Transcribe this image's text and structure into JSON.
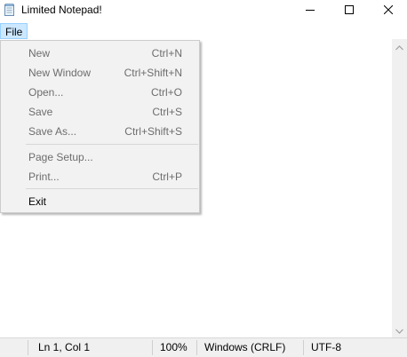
{
  "window": {
    "title": "Limited Notepad!",
    "icon": "notepad-icon",
    "controls": [
      "minimize-icon",
      "maximize-icon",
      "close-icon"
    ]
  },
  "menubar": {
    "items": [
      {
        "label": "File",
        "state": "open"
      }
    ]
  },
  "file_menu": {
    "groups": [
      [
        {
          "label": "New",
          "shortcut": "Ctrl+N",
          "enabled": false
        },
        {
          "label": "New Window",
          "shortcut": "Ctrl+Shift+N",
          "enabled": false
        },
        {
          "label": "Open...",
          "shortcut": "Ctrl+O",
          "enabled": false
        },
        {
          "label": "Save",
          "shortcut": "Ctrl+S",
          "enabled": false
        },
        {
          "label": "Save As...",
          "shortcut": "Ctrl+Shift+S",
          "enabled": false
        }
      ],
      [
        {
          "label": "Page Setup...",
          "shortcut": "",
          "enabled": false
        },
        {
          "label": "Print...",
          "shortcut": "Ctrl+P",
          "enabled": false
        }
      ],
      [
        {
          "label": "Exit",
          "shortcut": "",
          "enabled": true
        }
      ]
    ]
  },
  "editor": {
    "text": ""
  },
  "statusbar": {
    "position": "Ln 1, Col 1",
    "zoom": "100%",
    "line_ending": "Windows (CRLF)",
    "encoding": "UTF-8"
  },
  "colors": {
    "menu_highlight": "#cce8ff",
    "menu_highlight_border": "#99d1ff",
    "menu_background": "#f2f2f2",
    "disabled_text": "#6d6d6d"
  }
}
